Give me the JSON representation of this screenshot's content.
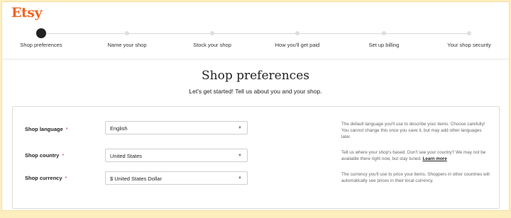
{
  "brand": {
    "logo": "Etsy",
    "accent": "#f1641e",
    "background": "#fdeebd"
  },
  "steps": [
    {
      "label": "Shop preferences",
      "active": true
    },
    {
      "label": "Name your shop",
      "active": false
    },
    {
      "label": "Stock your shop",
      "active": false
    },
    {
      "label": "How you'll get paid",
      "active": false
    },
    {
      "label": "Set up billing",
      "active": false
    },
    {
      "label": "Your shop security",
      "active": false
    }
  ],
  "page": {
    "title": "Shop preferences",
    "subtitle": "Let's get started! Tell us about you and your shop."
  },
  "form": {
    "language": {
      "label": "Shop language",
      "required": "*",
      "value": "English",
      "help": "The default language you'll use to describe your items. Choose carefully! You cannot change this once you save it, but may add other languages later."
    },
    "country": {
      "label": "Shop country",
      "required": "*",
      "value": "United States",
      "help": "Tell us where your shop's based. Don't see your country? We may not be available there right now, but stay tuned.",
      "help_link": "Learn more"
    },
    "currency": {
      "label": "Shop currency",
      "required": "*",
      "value": "$ United States Dollar",
      "help": "The currency you'll use to price your items. Shoppers in other countries will automatically see prices in their local currency."
    }
  }
}
